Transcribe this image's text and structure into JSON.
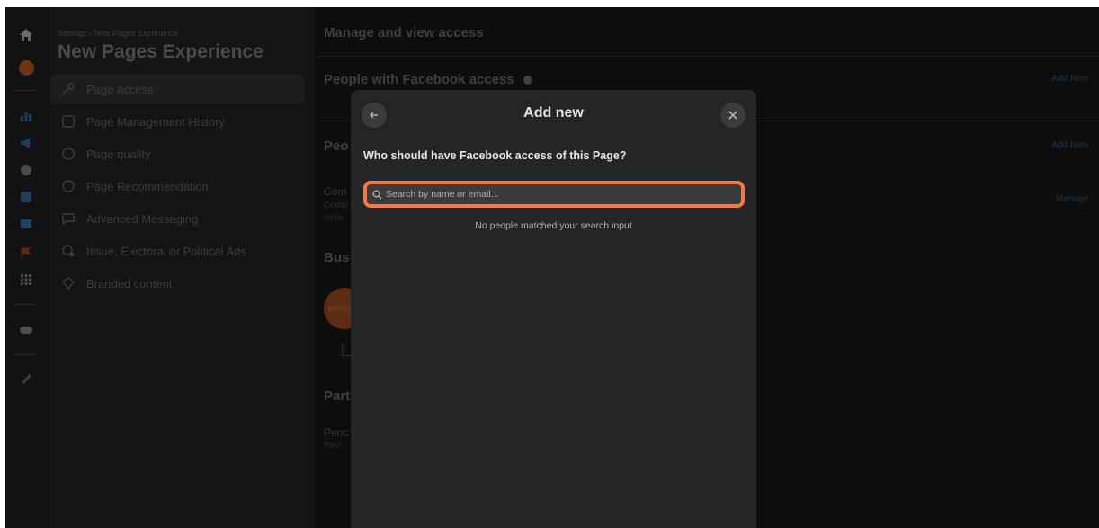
{
  "sidebar": {
    "breadcrumb": "Settings › New Pages Experience",
    "title": "New Pages Experience",
    "items": [
      {
        "label": "Page access",
        "icon": "key-icon"
      },
      {
        "label": "Page Management History",
        "icon": "history-icon"
      },
      {
        "label": "Page quality",
        "icon": "shield-icon"
      },
      {
        "label": "Page Recommendation",
        "icon": "recommendation-icon"
      },
      {
        "label": "Advanced Messaging",
        "icon": "chat-icon"
      },
      {
        "label": "Issue, Electoral or Political Ads",
        "icon": "political-ads-icon"
      },
      {
        "label": "Branded content",
        "icon": "branded-content-icon"
      }
    ]
  },
  "main": {
    "heading": "Manage and view access",
    "people_with_access": "People with Facebook access",
    "add_new_1": "Add New",
    "section2_partial": "Peo",
    "add_new_2": "Add New",
    "compliance_partial": "Com",
    "compliance_sub1": "Comp",
    "compliance_sub2": "viola",
    "manage": "Manage",
    "business_partial": "Bus",
    "avatar_text": "BEACH",
    "partners_partial": "Part",
    "pending_partial": "Penc",
    "pending_sub": "Revi"
  },
  "modal": {
    "title": "Add new",
    "question": "Who should have Facebook access of this Page?",
    "search_placeholder": "Search by name or email...",
    "no_results": "No people matched your search input"
  },
  "colors": {
    "highlight": "#f47a3f",
    "modal_bg": "#242526",
    "overlay": "#0b0b0b"
  }
}
